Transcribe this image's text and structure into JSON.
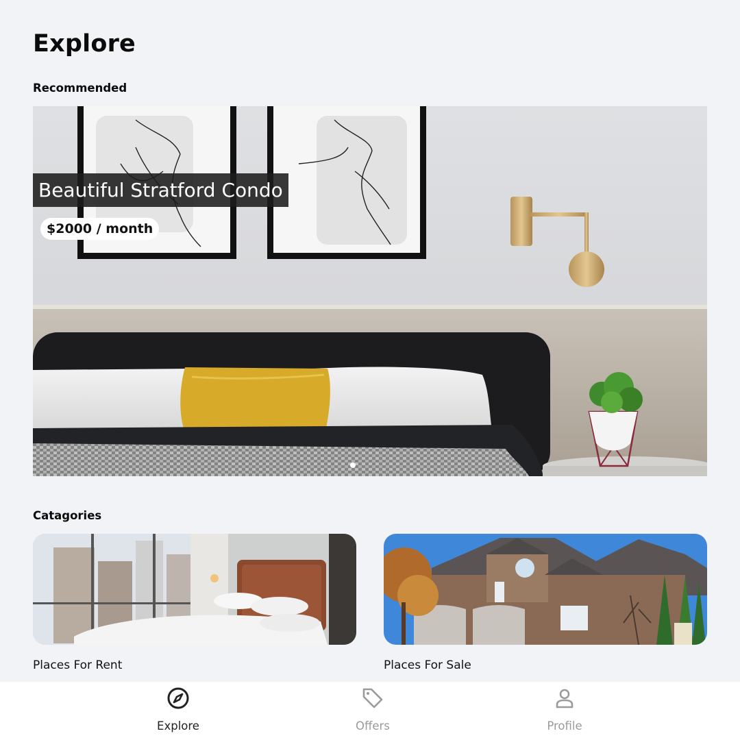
{
  "header": {
    "title": "Explore"
  },
  "recommended": {
    "label": "Recommended",
    "featured": {
      "title": "Beautiful Stratford Condo",
      "price": "$2000 / month"
    },
    "pager": {
      "count": 1,
      "active": 0
    }
  },
  "categories": {
    "label": "Catagories",
    "items": [
      {
        "label": "Places For Rent"
      },
      {
        "label": "Places For Sale"
      }
    ]
  },
  "bottom_nav": {
    "items": [
      {
        "label": "Explore",
        "icon": "compass-icon",
        "active": true
      },
      {
        "label": "Offers",
        "icon": "tag-icon",
        "active": false
      },
      {
        "label": "Profile",
        "icon": "person-icon",
        "active": false
      }
    ],
    "colors": {
      "active": "#222222",
      "inactive": "#9a9a9a"
    }
  }
}
